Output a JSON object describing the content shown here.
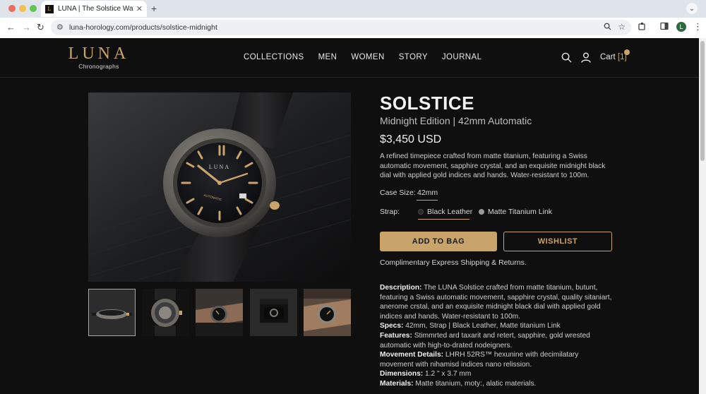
{
  "browser": {
    "tab_title": "LUNA | The Solstice Watch",
    "favicon_letter": "L",
    "url": "luna-horology.com/products/solstice-midnight",
    "profile_initial": "L"
  },
  "header": {
    "logo": "LUNA",
    "logo_sub": "Chronographs",
    "nav": [
      "COLLECTIONS",
      "MEN",
      "WOMEN",
      "STORY",
      "JOURNAL"
    ],
    "cart_label": "Cart",
    "cart_count": "[1]"
  },
  "product": {
    "title": "SOLSTICE",
    "subtitle": "Midnight Edition | 42mm Automatic",
    "price": "$3,450 USD",
    "description": "A refined timepiece crafted from matte titanium, featuring a Swiss automatic movement, sapphire crystal, and an exquisite midnight black dial with applied gold indices and hands. Water-resistant to 100m.",
    "dial_brand": "LUNA",
    "dial_text": "AUTOMATIC",
    "case_size_label": "Case Size:",
    "case_size_value": "42mm",
    "strap_label": "Strap:",
    "strap_options": [
      "Black Leather",
      "Matte Titanium Link"
    ],
    "strap_selected": "Black Leather",
    "add_to_bag": "ADD TO BAG",
    "wishlist": "WISHLIST",
    "shipping": "Complimentary Express Shipping & Returns."
  },
  "details": [
    {
      "label": "Description:",
      "text": " The LUNA Solstice  crafted from matte titanium, butunt, featuring a Swiss automatic movement, sapphire crystal, quality sitaniart, anerome crstal, and an exquisite midnight black dial with applied gold indices and hands. Water-resistant to 100m."
    },
    {
      "label": "Specs:",
      "text": " 42mm, Strap | Black Leather, Matte titanium Link"
    },
    {
      "label": "Features:",
      "text": " Stimmrted ard taxarit and retert, sapphire, gold wrested automatic with high-to-drated nodeigners."
    },
    {
      "label": "Movement Details:",
      "text": " LHRH 52RS™ hexunine with decimilatary movement with nihamisd indices nano relission."
    },
    {
      "label": "Dimensions:",
      "text": " 1.2 \" x 3.7 mm"
    },
    {
      "label": "Materials:",
      "text": " Matte titanium, moty:, alatic materials."
    }
  ],
  "colors": {
    "accent_gold": "#c9a46a",
    "page_bg": "#0f0f10"
  }
}
